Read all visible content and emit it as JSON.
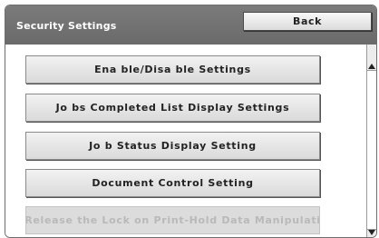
{
  "header": {
    "title": "Security Settings",
    "back_label": "Back"
  },
  "menu": [
    {
      "label": "Ena ble/Disa ble Settings",
      "enabled": true
    },
    {
      "label": "Jo bs Completed List Display Settings",
      "enabled": true
    },
    {
      "label": "Jo b Status Display Setting",
      "enabled": true
    },
    {
      "label": "Document Control Setting",
      "enabled": true
    },
    {
      "label": "Release the Lock on Print-Hold Data Manipulati",
      "enabled": false
    }
  ],
  "scrollbar": {
    "up_icon": "arrow-up-icon",
    "down_icon": "arrow-down-icon"
  }
}
